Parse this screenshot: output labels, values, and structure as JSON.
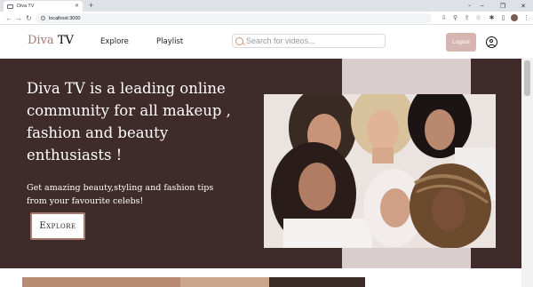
{
  "browser": {
    "tab_title": "Diva TV",
    "url": "localhost:3000"
  },
  "header": {
    "logo_first": "Diva",
    "logo_second": " TV",
    "nav": [
      {
        "label": "Explore"
      },
      {
        "label": "Playlist"
      }
    ],
    "search_placeholder": "Search for videos...",
    "logout_label": "Logout"
  },
  "hero": {
    "headline": "Diva TV is a leading online community for all makeup , fashion and beauty enthusiasts !",
    "subheadline": "Get amazing beauty,styling and fashion tips from your favourite celebs!",
    "cta_label": "Explore"
  },
  "colors": {
    "hero_bg": "#3f2b2a",
    "accent": "#a67a6f",
    "logout_bg": "#d7b6b1",
    "photo_strip": "#d9cecd"
  }
}
